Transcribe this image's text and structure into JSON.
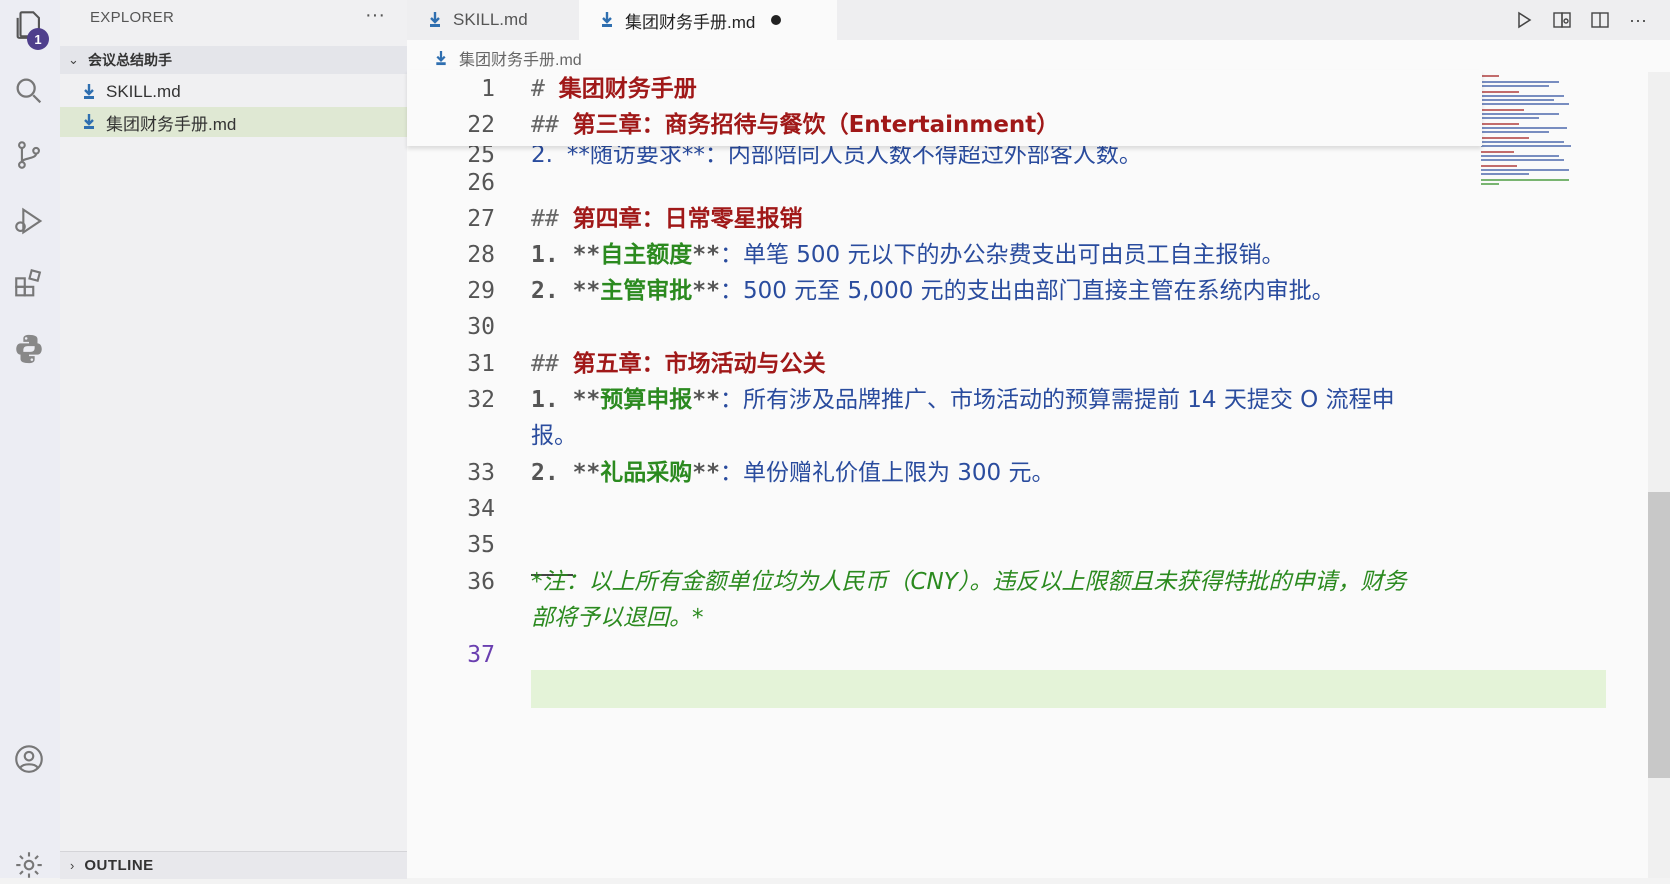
{
  "activity": {
    "badge": "1",
    "items": [
      "explorer-icon",
      "search-icon",
      "source-control-icon",
      "run-debug-icon",
      "extensions-icon",
      "python-icon",
      "account-icon",
      "settings-gear-icon"
    ]
  },
  "sidebar": {
    "title": "EXPLORER",
    "more": "···",
    "folder": "会议总结助手",
    "files": [
      "SKILL.md",
      "集团财务手册.md"
    ],
    "outline": "OUTLINE"
  },
  "tabs": [
    {
      "label": "SKILL.md",
      "active": false
    },
    {
      "label": "集团财务手册.md",
      "active": true,
      "dirty": true
    }
  ],
  "breadcrumb": "集团财务手册.md",
  "lines": {
    "l1": {
      "num": "1",
      "hash": "#",
      "title": "集团财务手册"
    },
    "l22": {
      "num": "22",
      "hash": "##",
      "title": "第三章：商务招待与餐饮（Entertainment）"
    },
    "l25": {
      "num": "25",
      "prefix": "2.",
      "partial": "**随访要求**：内部陪同人员人数不得超过外部客人数。"
    },
    "l26": {
      "num": "26"
    },
    "l27": {
      "num": "27",
      "hash": "##",
      "title": "第四章：日常零星报销"
    },
    "l28": {
      "num": "28",
      "prefix": "1.",
      "stars": "**",
      "bold": "自主额度",
      "rest": "：单笔 500 元以下的办公杂费支出可由员工自主报销。"
    },
    "l29": {
      "num": "29",
      "prefix": "2.",
      "stars": "**",
      "bold": "主管审批",
      "rest": "：500 元至 5,000 元的支出由部门直接主管在系统内审批。"
    },
    "l30": {
      "num": "30"
    },
    "l31": {
      "num": "31",
      "hash": "##",
      "title": "第五章：市场活动与公关"
    },
    "l32": {
      "num": "32",
      "prefix": "1.",
      "stars": "**",
      "bold": "预算申报",
      "rest": "：所有涉及品牌推广、市场活动的预算需提前 14 天提交 O 流程申",
      "wrap": "报。"
    },
    "l33": {
      "num": "33",
      "prefix": "2.",
      "stars": "**",
      "bold": "礼品采购",
      "rest": "：单份赠礼价值上限为 300 元。"
    },
    "l34": {
      "num": "34"
    },
    "l35": {
      "num": "35"
    },
    "l36": {
      "num": "36",
      "text": "*注：以上所有金额单位均为人民币（CNY）。违反以上限额且未获得特批的申请，财务",
      "wrap": "部将予以退回。*"
    },
    "l37": {
      "num": "37"
    }
  },
  "colors": {
    "heading": "#a01818",
    "bold": "#2b8a1f",
    "body": "#2a4c9e",
    "current_line": "#e4f3d8",
    "active_file": "#dfe8d3"
  }
}
